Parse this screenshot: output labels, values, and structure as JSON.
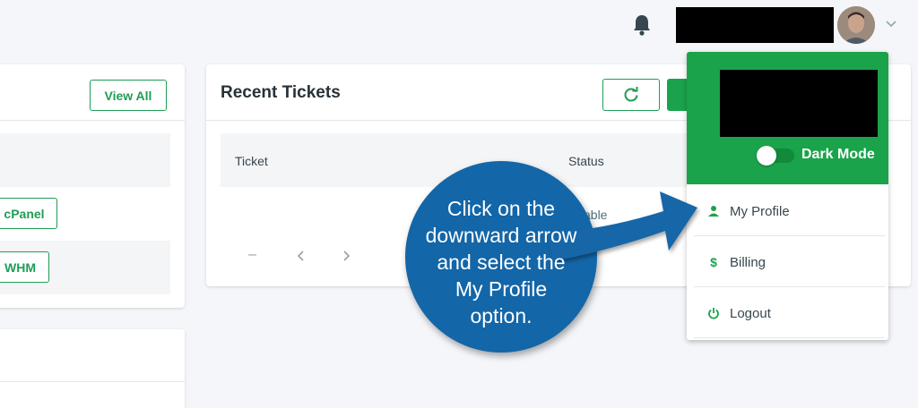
{
  "header": {
    "notifications_icon": "bell-icon",
    "dropdown_icon": "chevron-down-icon"
  },
  "left_panel": {
    "view_all_label": "View All",
    "cpanel_label": "cPanel",
    "whm_label": "WHM"
  },
  "tickets": {
    "title": "Recent Tickets",
    "refresh_icon": "refresh-icon",
    "columns": [
      "Ticket",
      "Status"
    ],
    "partial_cell_text": "able",
    "pager": {
      "dash": "–",
      "prev_icon": "chevron-left-icon",
      "next_icon": "chevron-right-icon"
    }
  },
  "user_menu": {
    "dark_mode_label": "Dark Mode",
    "items": [
      {
        "label": "My Profile",
        "icon": "person-icon"
      },
      {
        "label": "Billing",
        "icon": "dollar-icon"
      },
      {
        "label": "Logout",
        "icon": "power-icon"
      }
    ]
  },
  "callout": {
    "line1": "Click on the",
    "line2": "downward arrow",
    "line3": "and select the",
    "line4": "My Profile",
    "line5": "option."
  },
  "colors": {
    "brand_green": "#1aa34a",
    "callout_blue": "#1366a8",
    "background": "#f5f6fa"
  }
}
